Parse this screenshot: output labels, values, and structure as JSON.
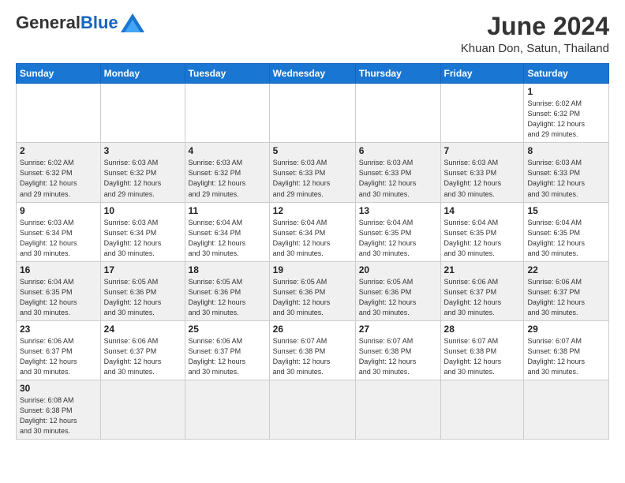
{
  "logo": {
    "general": "General",
    "blue": "Blue"
  },
  "title": "June 2024",
  "location": "Khuan Don, Satun, Thailand",
  "days_header": [
    "Sunday",
    "Monday",
    "Tuesday",
    "Wednesday",
    "Thursday",
    "Friday",
    "Saturday"
  ],
  "weeks": [
    {
      "shaded": false,
      "days": [
        {
          "num": "",
          "info": ""
        },
        {
          "num": "",
          "info": ""
        },
        {
          "num": "",
          "info": ""
        },
        {
          "num": "",
          "info": ""
        },
        {
          "num": "",
          "info": ""
        },
        {
          "num": "",
          "info": ""
        },
        {
          "num": "1",
          "info": "Sunrise: 6:02 AM\nSunset: 6:32 PM\nDaylight: 12 hours\nand 29 minutes."
        }
      ]
    },
    {
      "shaded": true,
      "days": [
        {
          "num": "2",
          "info": "Sunrise: 6:02 AM\nSunset: 6:32 PM\nDaylight: 12 hours\nand 29 minutes."
        },
        {
          "num": "3",
          "info": "Sunrise: 6:03 AM\nSunset: 6:32 PM\nDaylight: 12 hours\nand 29 minutes."
        },
        {
          "num": "4",
          "info": "Sunrise: 6:03 AM\nSunset: 6:32 PM\nDaylight: 12 hours\nand 29 minutes."
        },
        {
          "num": "5",
          "info": "Sunrise: 6:03 AM\nSunset: 6:33 PM\nDaylight: 12 hours\nand 29 minutes."
        },
        {
          "num": "6",
          "info": "Sunrise: 6:03 AM\nSunset: 6:33 PM\nDaylight: 12 hours\nand 30 minutes."
        },
        {
          "num": "7",
          "info": "Sunrise: 6:03 AM\nSunset: 6:33 PM\nDaylight: 12 hours\nand 30 minutes."
        },
        {
          "num": "8",
          "info": "Sunrise: 6:03 AM\nSunset: 6:33 PM\nDaylight: 12 hours\nand 30 minutes."
        }
      ]
    },
    {
      "shaded": false,
      "days": [
        {
          "num": "9",
          "info": "Sunrise: 6:03 AM\nSunset: 6:34 PM\nDaylight: 12 hours\nand 30 minutes."
        },
        {
          "num": "10",
          "info": "Sunrise: 6:03 AM\nSunset: 6:34 PM\nDaylight: 12 hours\nand 30 minutes."
        },
        {
          "num": "11",
          "info": "Sunrise: 6:04 AM\nSunset: 6:34 PM\nDaylight: 12 hours\nand 30 minutes."
        },
        {
          "num": "12",
          "info": "Sunrise: 6:04 AM\nSunset: 6:34 PM\nDaylight: 12 hours\nand 30 minutes."
        },
        {
          "num": "13",
          "info": "Sunrise: 6:04 AM\nSunset: 6:35 PM\nDaylight: 12 hours\nand 30 minutes."
        },
        {
          "num": "14",
          "info": "Sunrise: 6:04 AM\nSunset: 6:35 PM\nDaylight: 12 hours\nand 30 minutes."
        },
        {
          "num": "15",
          "info": "Sunrise: 6:04 AM\nSunset: 6:35 PM\nDaylight: 12 hours\nand 30 minutes."
        }
      ]
    },
    {
      "shaded": true,
      "days": [
        {
          "num": "16",
          "info": "Sunrise: 6:04 AM\nSunset: 6:35 PM\nDaylight: 12 hours\nand 30 minutes."
        },
        {
          "num": "17",
          "info": "Sunrise: 6:05 AM\nSunset: 6:36 PM\nDaylight: 12 hours\nand 30 minutes."
        },
        {
          "num": "18",
          "info": "Sunrise: 6:05 AM\nSunset: 6:36 PM\nDaylight: 12 hours\nand 30 minutes."
        },
        {
          "num": "19",
          "info": "Sunrise: 6:05 AM\nSunset: 6:36 PM\nDaylight: 12 hours\nand 30 minutes."
        },
        {
          "num": "20",
          "info": "Sunrise: 6:05 AM\nSunset: 6:36 PM\nDaylight: 12 hours\nand 30 minutes."
        },
        {
          "num": "21",
          "info": "Sunrise: 6:06 AM\nSunset: 6:37 PM\nDaylight: 12 hours\nand 30 minutes."
        },
        {
          "num": "22",
          "info": "Sunrise: 6:06 AM\nSunset: 6:37 PM\nDaylight: 12 hours\nand 30 minutes."
        }
      ]
    },
    {
      "shaded": false,
      "days": [
        {
          "num": "23",
          "info": "Sunrise: 6:06 AM\nSunset: 6:37 PM\nDaylight: 12 hours\nand 30 minutes."
        },
        {
          "num": "24",
          "info": "Sunrise: 6:06 AM\nSunset: 6:37 PM\nDaylight: 12 hours\nand 30 minutes."
        },
        {
          "num": "25",
          "info": "Sunrise: 6:06 AM\nSunset: 6:37 PM\nDaylight: 12 hours\nand 30 minutes."
        },
        {
          "num": "26",
          "info": "Sunrise: 6:07 AM\nSunset: 6:38 PM\nDaylight: 12 hours\nand 30 minutes."
        },
        {
          "num": "27",
          "info": "Sunrise: 6:07 AM\nSunset: 6:38 PM\nDaylight: 12 hours\nand 30 minutes."
        },
        {
          "num": "28",
          "info": "Sunrise: 6:07 AM\nSunset: 6:38 PM\nDaylight: 12 hours\nand 30 minutes."
        },
        {
          "num": "29",
          "info": "Sunrise: 6:07 AM\nSunset: 6:38 PM\nDaylight: 12 hours\nand 30 minutes."
        }
      ]
    },
    {
      "shaded": true,
      "days": [
        {
          "num": "30",
          "info": "Sunrise: 6:08 AM\nSunset: 6:38 PM\nDaylight: 12 hours\nand 30 minutes."
        },
        {
          "num": "",
          "info": ""
        },
        {
          "num": "",
          "info": ""
        },
        {
          "num": "",
          "info": ""
        },
        {
          "num": "",
          "info": ""
        },
        {
          "num": "",
          "info": ""
        },
        {
          "num": "",
          "info": ""
        }
      ]
    }
  ]
}
